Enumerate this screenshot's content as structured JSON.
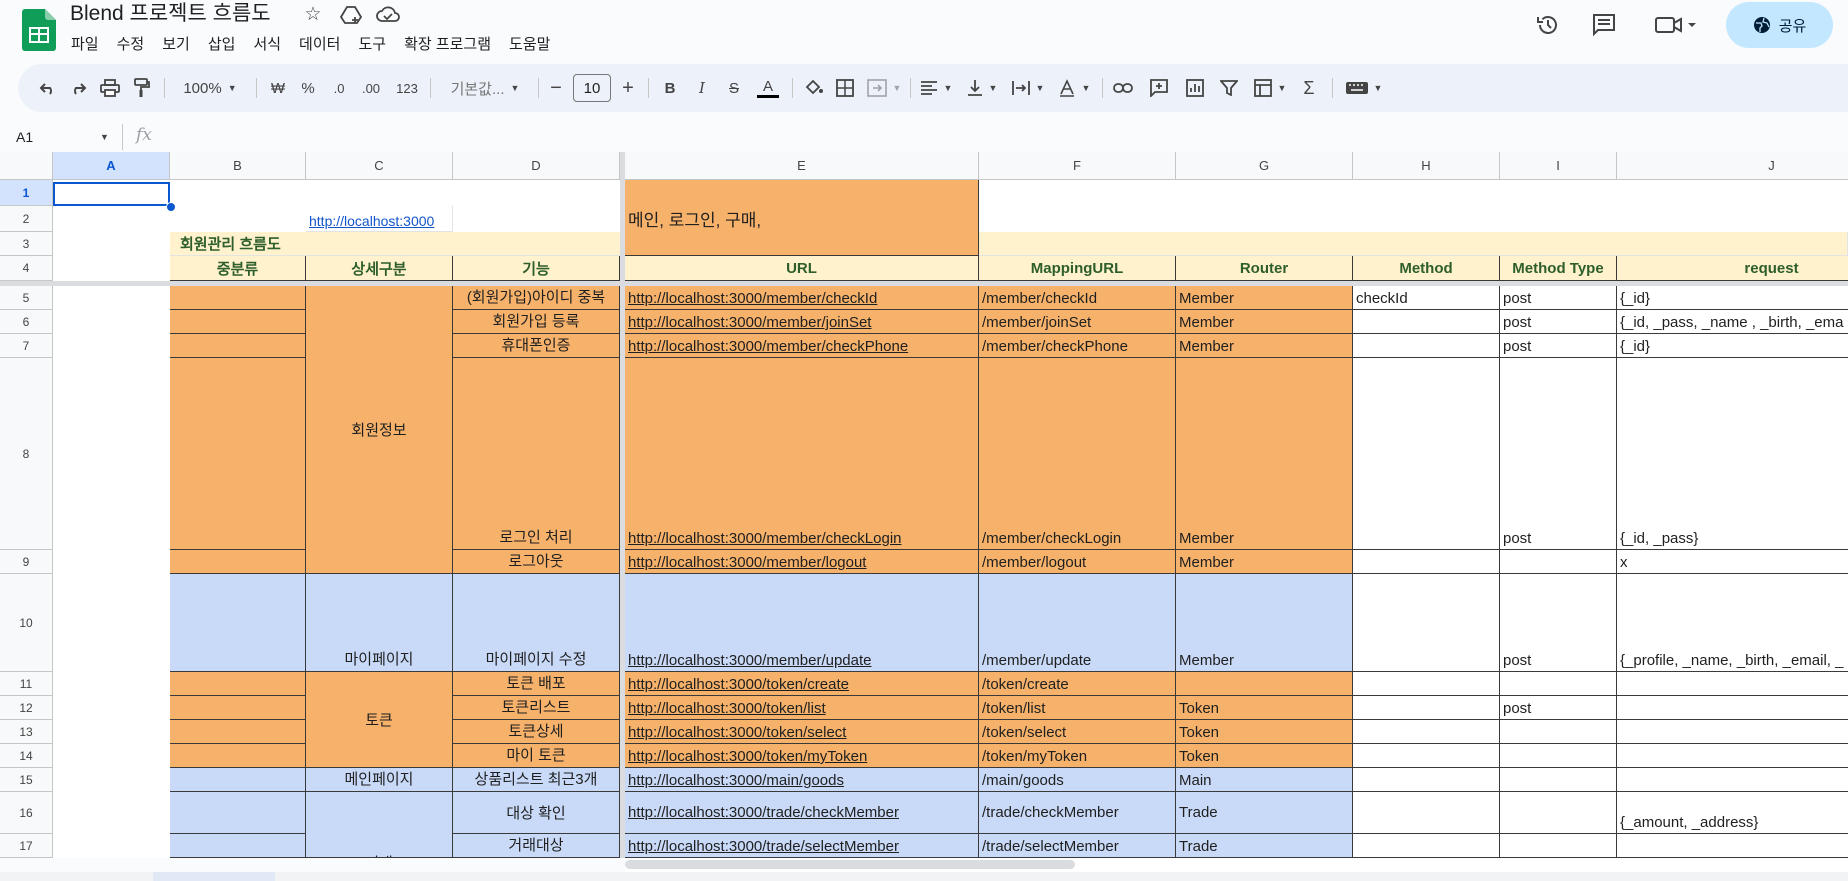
{
  "doc": {
    "title": "Blend 프로젝트 흐름도"
  },
  "menu": [
    "파일",
    "수정",
    "보기",
    "삽입",
    "서식",
    "데이터",
    "도구",
    "확장 프로그램",
    "도움말"
  ],
  "header": {
    "share_label": "공유"
  },
  "toolbar": {
    "zoom": "100%",
    "currency": "₩",
    "percent": "%",
    "dec_decrease": ".0",
    "dec_increase": ".00",
    "format_123": "123",
    "font": "기본값...",
    "font_size": "10",
    "minus": "−",
    "plus": "+"
  },
  "formula": {
    "cell_ref": "A1",
    "fx": "fx"
  },
  "columns": [
    "A",
    "B",
    "C",
    "D",
    "E",
    "F",
    "G",
    "H",
    "I",
    "J"
  ],
  "rows": [
    "1",
    "2",
    "3",
    "4",
    "5",
    "6",
    "7",
    "8",
    "9",
    "10",
    "11",
    "12",
    "13",
    "14",
    "15",
    "16",
    "17"
  ],
  "cells": {
    "c2": "http://localhost:3000",
    "e2": "메인, 로그인, 구매,",
    "b3": "회원관리 흐름도",
    "hdr": [
      "중분류",
      "상세구분",
      "기능",
      "URL",
      "MappingURL",
      "Router",
      "Method",
      "Method Type",
      "request"
    ],
    "member": "회원정보",
    "mypage": "마이페이지",
    "token": "토큰",
    "mainpage": "메인페이지",
    "trade": "거래",
    "r5": [
      "(회원가입)아이디 중복",
      "http://localhost:3000/member/checkId",
      "/member/checkId",
      "Member",
      "checkId",
      "post",
      "{_id}"
    ],
    "r6": [
      "회원가입 등록",
      "http://localhost:3000/member/joinSet",
      "/member/joinSet",
      "Member",
      "",
      "post",
      "{_id, _pass, _name , _birth, _ema"
    ],
    "r7": [
      "휴대폰인증",
      "http://localhost:3000/member/checkPhone",
      "/member/checkPhone",
      "Member",
      "",
      "post",
      "{_id}"
    ],
    "r8": [
      "로그인 처리",
      "http://localhost:3000/member/checkLogin",
      "/member/checkLogin",
      "Member",
      "",
      "post",
      "{_id, _pass}"
    ],
    "r9": [
      "로그아웃",
      "http://localhost:3000/member/logout",
      "/member/logout",
      "Member",
      "",
      "",
      "x"
    ],
    "r10": [
      "마이페이지 수정",
      "http://localhost:3000/member/update",
      "/member/update",
      "Member",
      "",
      "post",
      "{_profile, _name, _birth, _email, _"
    ],
    "r11": [
      "토큰 배포",
      "http://localhost:3000/token/create",
      "/token/create",
      "",
      "",
      "",
      ""
    ],
    "r12": [
      "토큰리스트",
      "http://localhost:3000/token/list",
      "/token/list",
      "Token",
      "",
      "post",
      ""
    ],
    "r13": [
      "토큰상세",
      "http://localhost:3000/token/select",
      "/token/select",
      "Token",
      "",
      "",
      ""
    ],
    "r14": [
      "마이 토큰",
      "http://localhost:3000/token/myToken",
      "/token/myToken",
      "Token",
      "",
      "",
      ""
    ],
    "r15": [
      "상품리스트 최근3개",
      "http://localhost:3000/main/goods",
      "/main/goods",
      "Main",
      "",
      "",
      ""
    ],
    "r16": [
      "대상 확인",
      "http://localhost:3000/trade/checkMember",
      "/trade/checkMember",
      "Trade",
      "",
      "",
      "{_amount, _address}"
    ],
    "r17": [
      "거래대상",
      "http://localhost:3000/trade/selectMember",
      "/trade/selectMember",
      "Trade",
      "",
      "",
      ""
    ]
  },
  "colors": {
    "orange": "#f6b26b",
    "blue": "#c9daf8",
    "yellow": "#fff2cc",
    "header_text": "#2d5e2b",
    "accent": "#0b57d0"
  }
}
